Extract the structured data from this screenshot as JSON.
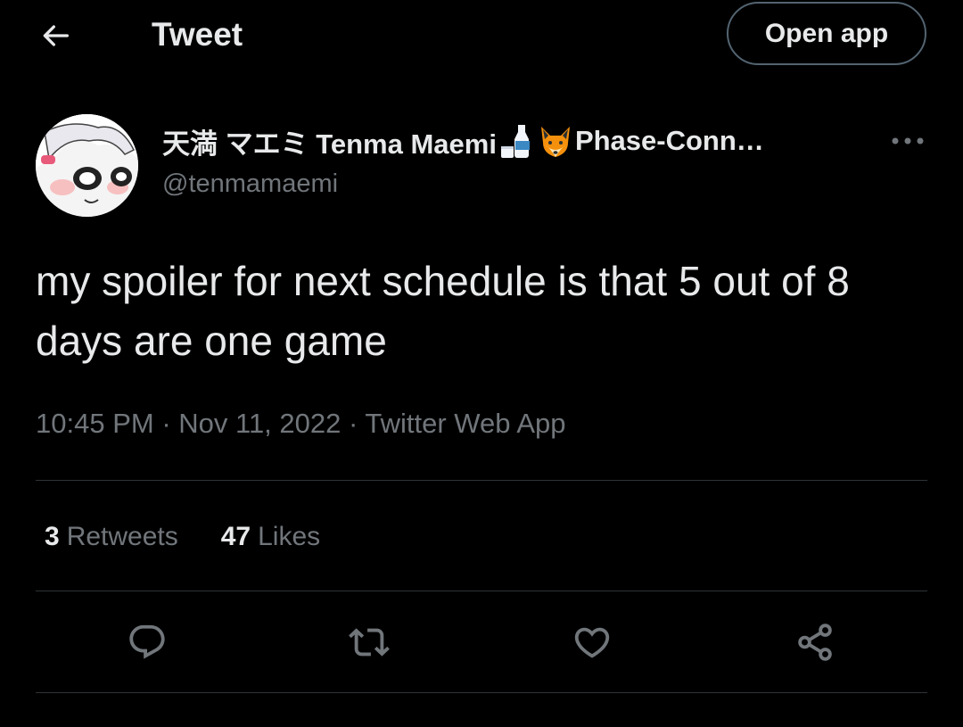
{
  "header": {
    "title": "Tweet",
    "open_app_label": "Open app"
  },
  "author": {
    "name_part1": "天満 マエミ Tenma Maemi",
    "name_part2": "Phase-Conn…",
    "handle": "@tenmamaemi",
    "emojis": [
      "sake-bottle-icon",
      "fox-face-icon"
    ]
  },
  "tweet": {
    "text": "my spoiler for next schedule is that 5 out of 8 days are one game",
    "time": "10:45 PM",
    "sep1": " · ",
    "date": "Nov 11, 2022",
    "sep2": " · ",
    "source": "Twitter Web App"
  },
  "stats": {
    "retweets_count": "3",
    "retweets_label": "Retweets",
    "likes_count": "47",
    "likes_label": "Likes"
  },
  "actions": [
    "reply-icon",
    "retweet-icon",
    "like-icon",
    "share-icon"
  ],
  "colors": {
    "background": "#000000",
    "text_primary": "#e7e9ea",
    "text_secondary": "#71767b",
    "divider": "#2f3336",
    "button_border": "#536471"
  }
}
